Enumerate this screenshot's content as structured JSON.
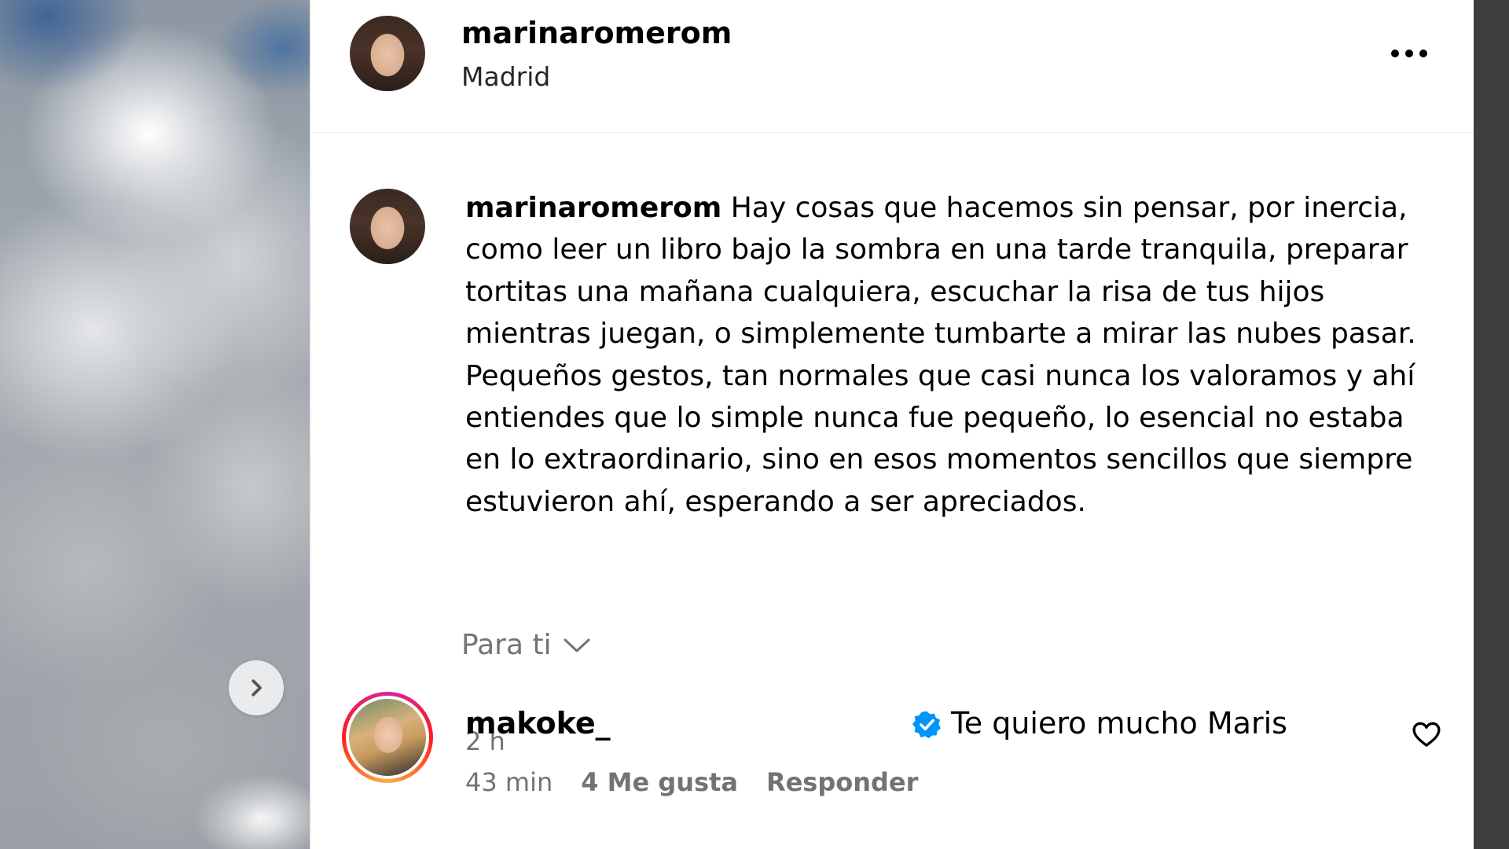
{
  "post": {
    "username": "marinaromerom",
    "location": "Madrid"
  },
  "caption": {
    "username": "marinaromerom",
    "text": "Hay cosas que hacemos sin pensar, por inercia, como leer un libro bajo la sombra en una tarde tranquila, preparar tortitas una mañana cualquiera, escuchar la risa de tus hijos mientras juegan, o simplemente tumbarte a mirar las nubes pasar. Pequeños gestos, tan normales que casi nunca los valoramos y ahí entiendes que lo simple nunca fue pequeño, lo esencial no estaba en lo extraordinario, sino en esos momentos sencillos que siempre estuvieron ahí, esperando a ser apreciados.",
    "time": "2 h"
  },
  "comments_sort": {
    "label": "Para ti"
  },
  "comment": {
    "username": "makoke_",
    "text": "Te quiero mucho Maris",
    "time": "43 min",
    "likes": "4 Me gusta",
    "reply": "Responder"
  },
  "icons": {
    "more": "more-options-icon",
    "next": "chevron-right-icon",
    "sort": "chevron-down-icon",
    "verified": "verified-badge-icon",
    "like": "heart-icon"
  },
  "colors": {
    "secondary_text": "#737373",
    "verified": "#0095f6",
    "backdrop": "#3d3d3d"
  }
}
